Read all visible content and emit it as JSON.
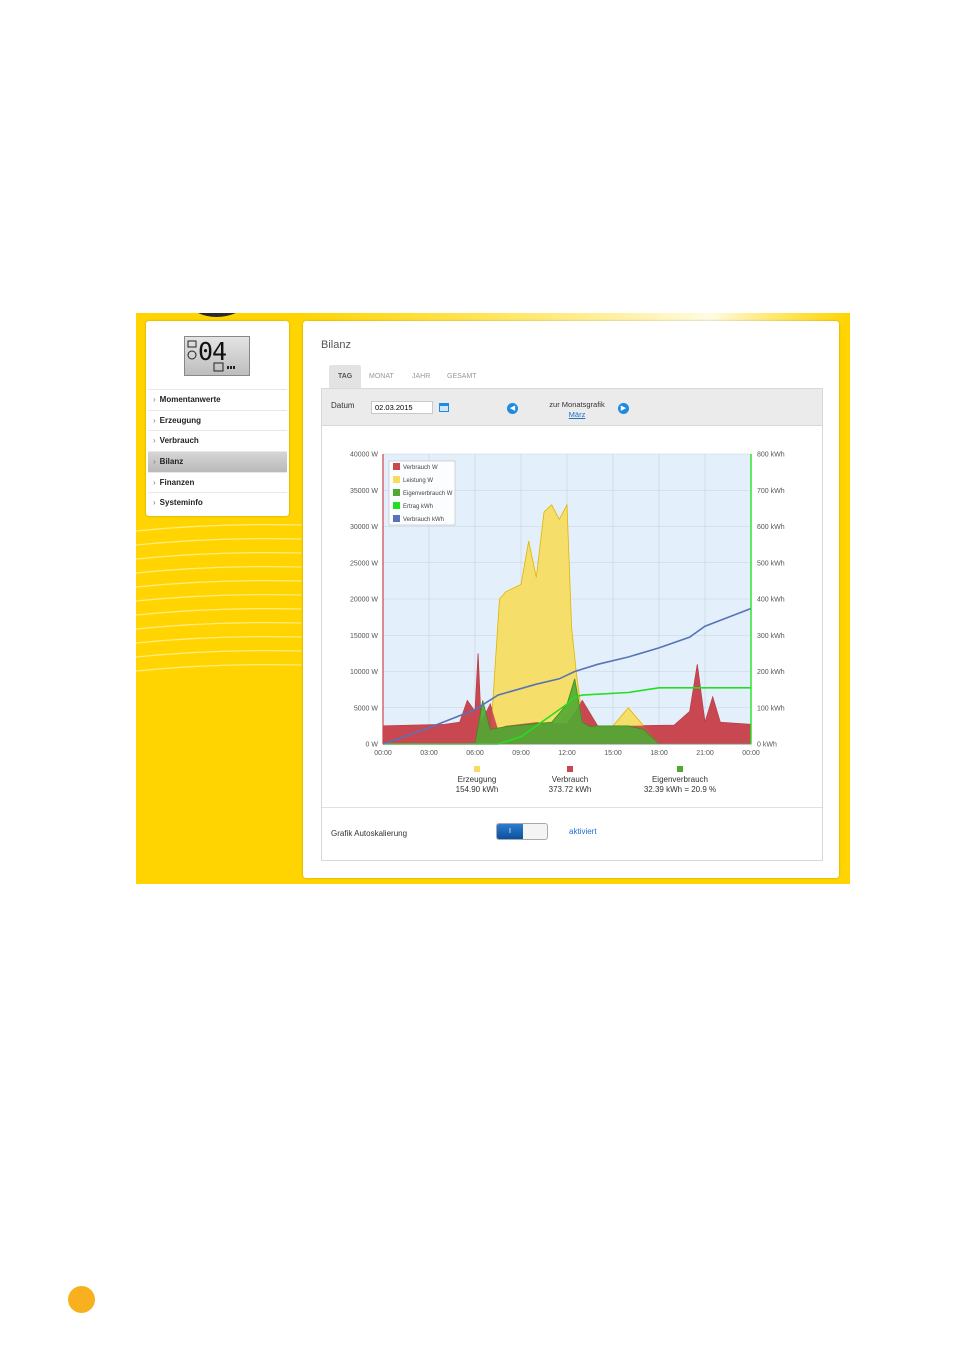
{
  "sidebar": {
    "lcd_digits": "04",
    "items": [
      {
        "label": "Momentanwerte"
      },
      {
        "label": "Erzeugung"
      },
      {
        "label": "Verbrauch"
      },
      {
        "label": "Bilanz"
      },
      {
        "label": "Finanzen"
      },
      {
        "label": "Systeminfo"
      }
    ],
    "active_index": 3
  },
  "main": {
    "title": "Bilanz",
    "tabs": [
      {
        "label": "TAG"
      },
      {
        "label": "MONAT"
      },
      {
        "label": "JAHR"
      },
      {
        "label": "GESAMT"
      }
    ],
    "active_tab": 0,
    "toolbar": {
      "date_label": "Datum",
      "date_value": "02.03.2015",
      "prev_icon": "chevron-left-icon",
      "next_icon": "chevron-right-icon",
      "month_link_label": "zur Monatsgrafik",
      "month_link": "März"
    },
    "autoscale": {
      "label": "Grafik Autoskalierung",
      "toggle_text": "I",
      "status": "aktiviert"
    }
  },
  "colors": {
    "frame": "#ffd400",
    "accent_blue": "#1e8ae0",
    "verbrauch": "#c9474f",
    "leistung": "#f7dc5e",
    "eigenverbrauch": "#52a833",
    "ertrag_kwh": "#21e021",
    "verbrauch_kwh": "#5873b8"
  },
  "chart_data": {
    "type": "area",
    "y_left_label_suffix": "W",
    "y_right_label_suffix": "kWh",
    "ylim_left": [
      0,
      40000
    ],
    "ylim_right": [
      0,
      800
    ],
    "y_left_ticks": [
      "0 W",
      "5000 W",
      "10000 W",
      "15000 W",
      "20000 W",
      "25000 W",
      "30000 W",
      "35000 W",
      "40000 W"
    ],
    "y_right_ticks": [
      "0 kWh",
      "100 kWh",
      "200 kWh",
      "300 kWh",
      "400 kWh",
      "500 kWh",
      "600 kWh",
      "700 kWh",
      "800 kWh"
    ],
    "x_ticks": [
      "00:00",
      "03:00",
      "06:00",
      "09:00",
      "12:00",
      "15:00",
      "18:00",
      "21:00",
      "00:00"
    ],
    "grid": true,
    "legend_position": "top-left",
    "series": [
      {
        "name": "Verbrauch W",
        "axis": "left",
        "x_hours": [
          0,
          4,
          5,
          5.5,
          6,
          6.2,
          6.4,
          7,
          7.5,
          8,
          10,
          12,
          13,
          14,
          16,
          19,
          20,
          20.5,
          21,
          21.5,
          22,
          24
        ],
        "values": [
          2500,
          2700,
          3000,
          6000,
          4500,
          12500,
          3000,
          5500,
          2000,
          2500,
          3000,
          2800,
          6000,
          2500,
          2500,
          2600,
          4500,
          11000,
          3000,
          6500,
          3000,
          2700
        ]
      },
      {
        "name": "Leistung W",
        "axis": "left",
        "x_hours": [
          0,
          6,
          7,
          7.6,
          8,
          9,
          9.5,
          10,
          10.5,
          11,
          11.5,
          12,
          12.3,
          12.6,
          13,
          13.5,
          14,
          15,
          16,
          17,
          18,
          24
        ],
        "values": [
          0,
          0,
          500,
          20000,
          21000,
          22000,
          28000,
          23000,
          32000,
          33000,
          31000,
          33000,
          16000,
          10000,
          3500,
          2000,
          2000,
          2500,
          5000,
          2500,
          0,
          0
        ]
      },
      {
        "name": "Eigenverbrauch W",
        "axis": "left",
        "x_hours": [
          0,
          6,
          6.5,
          7,
          8,
          9,
          10,
          11,
          12,
          12.5,
          13,
          13.5,
          14,
          15,
          16,
          17,
          18,
          24
        ],
        "values": [
          0,
          0,
          6000,
          2000,
          2400,
          2600,
          2800,
          3000,
          5500,
          9000,
          3000,
          2400,
          2500,
          2500,
          2500,
          2000,
          0,
          0
        ]
      },
      {
        "name": "Ertrag kWh",
        "axis": "right",
        "x_hours": [
          0,
          7.5,
          9,
          10,
          11,
          12,
          12.5,
          13,
          16,
          18,
          24
        ],
        "values": [
          0,
          0,
          20,
          50,
          80,
          110,
          130,
          135,
          142,
          154.9,
          154.9
        ]
      },
      {
        "name": "Verbrauch kWh",
        "axis": "right",
        "x_hours": [
          0,
          3,
          6,
          7.5,
          10,
          11.5,
          12.5,
          14,
          16,
          18,
          20,
          21,
          24
        ],
        "values": [
          0,
          45,
          95,
          135,
          165,
          180,
          200,
          220,
          240,
          265,
          295,
          325,
          373.72
        ]
      }
    ],
    "summary": [
      {
        "name": "Erzeugung",
        "value": "154.90 kWh",
        "color": "#f7dc5e"
      },
      {
        "name": "Verbrauch",
        "value": "373.72 kWh",
        "color": "#c9474f"
      },
      {
        "name": "Eigenverbrauch",
        "value": "32.39 kWh = 20.9 %",
        "color": "#52a833"
      }
    ]
  }
}
